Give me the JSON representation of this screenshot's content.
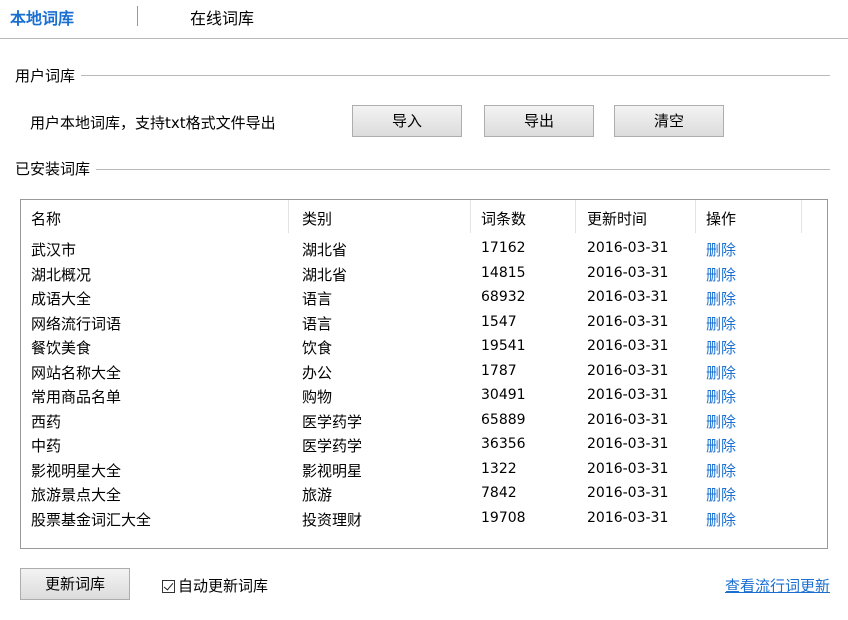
{
  "tabs": {
    "local": "本地词库",
    "online": "在线词库"
  },
  "user_group": {
    "title": "用户词库",
    "description": "用户本地词库，支持txt格式文件导出",
    "import_label": "导入",
    "export_label": "导出",
    "clear_label": "清空"
  },
  "installed_group": {
    "title": "已安装词库",
    "columns": {
      "name": "名称",
      "category": "类别",
      "count": "词条数",
      "updated": "更新时间",
      "action": "操作"
    },
    "rows": [
      {
        "name": "武汉市",
        "category": "湖北省",
        "count": "17162",
        "updated": "2016-03-31",
        "action": "删除"
      },
      {
        "name": "湖北概况",
        "category": "湖北省",
        "count": "14815",
        "updated": "2016-03-31",
        "action": "删除"
      },
      {
        "name": "成语大全",
        "category": "语言",
        "count": "68932",
        "updated": "2016-03-31",
        "action": "删除"
      },
      {
        "name": "网络流行词语",
        "category": "语言",
        "count": "1547",
        "updated": "2016-03-31",
        "action": "删除"
      },
      {
        "name": "餐饮美食",
        "category": "饮食",
        "count": "19541",
        "updated": "2016-03-31",
        "action": "删除"
      },
      {
        "name": "网站名称大全",
        "category": "办公",
        "count": "1787",
        "updated": "2016-03-31",
        "action": "删除"
      },
      {
        "name": "常用商品名单",
        "category": "购物",
        "count": "30491",
        "updated": "2016-03-31",
        "action": "删除"
      },
      {
        "name": "西药",
        "category": "医学药学",
        "count": "65889",
        "updated": "2016-03-31",
        "action": "删除"
      },
      {
        "name": "中药",
        "category": "医学药学",
        "count": "36356",
        "updated": "2016-03-31",
        "action": "删除"
      },
      {
        "name": "影视明星大全",
        "category": "影视明星",
        "count": "1322",
        "updated": "2016-03-31",
        "action": "删除"
      },
      {
        "name": "旅游景点大全",
        "category": "旅游",
        "count": "7842",
        "updated": "2016-03-31",
        "action": "删除"
      },
      {
        "name": "股票基金词汇大全",
        "category": "投资理财",
        "count": "19708",
        "updated": "2016-03-31",
        "action": "删除"
      }
    ]
  },
  "footer": {
    "update_label": "更新词库",
    "auto_update_label": "自动更新词库",
    "auto_update_checked": true,
    "view_trending_label": "查看流行词更新"
  },
  "colors": {
    "accent": "#1a6fd1",
    "divider": "#b9b9b9"
  }
}
